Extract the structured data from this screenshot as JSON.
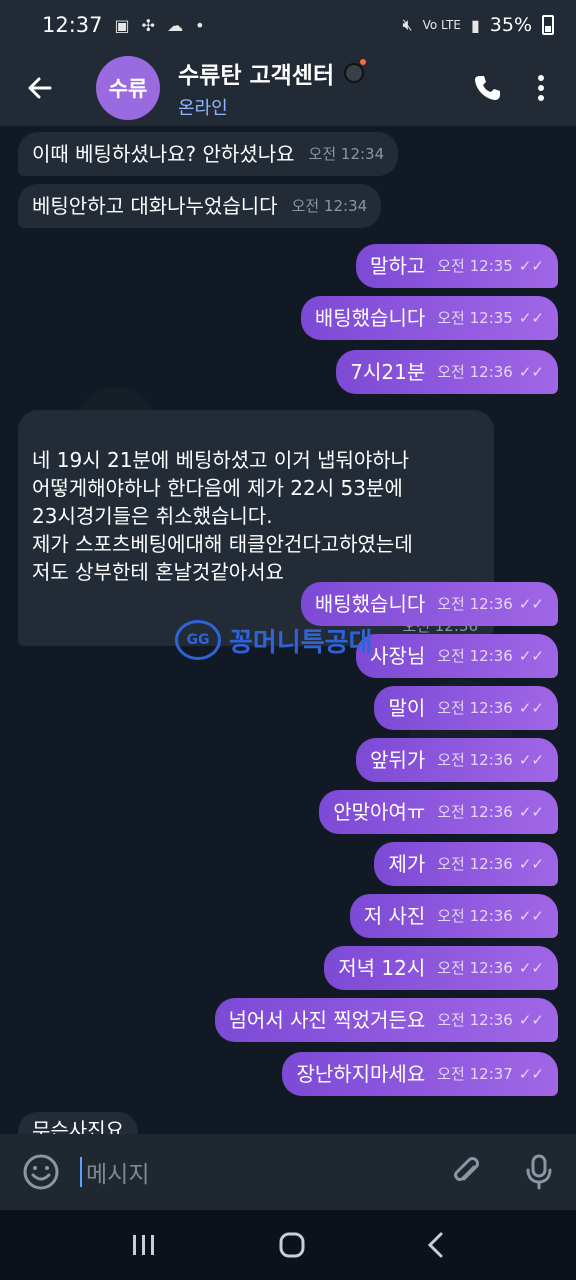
{
  "status_bar": {
    "time": "12:37",
    "dot": "•",
    "carrier": "Vo LTE",
    "battery": "35%"
  },
  "header": {
    "avatar_text": "수류",
    "title": "수류탄 고객센터",
    "status": "온라인"
  },
  "messages": [
    {
      "side": "in",
      "text": "이때 베팅하셨나요? 안하셨나요",
      "time": "오전 12:34"
    },
    {
      "side": "in",
      "text": "베팅안하고 대화나누었습니다",
      "time": "오전 12:34"
    },
    {
      "side": "out",
      "text": "말하고",
      "time": "오전 12:35"
    },
    {
      "side": "out",
      "text": "배팅했습니다",
      "time": "오전 12:35"
    },
    {
      "side": "out",
      "text": "7시21분",
      "time": "오전 12:36"
    },
    {
      "side": "in",
      "text": "네 19시 21분에 베팅하셨고 이거 냅둬야하나\n어떻게해야하나 한다음에 제가 22시 53분에\n23시경기들은 취소했습니다.\n제가 스포츠베팅에대해 태클안건다고하였는데\n저도 상부한테 혼날것같아서요",
      "time": "오전 12:36"
    },
    {
      "side": "out",
      "text": "배팅했습니다",
      "time": "오전 12:36"
    },
    {
      "side": "out",
      "text": "사장님",
      "time": "오전 12:36"
    },
    {
      "side": "out",
      "text": "말이",
      "time": "오전 12:36"
    },
    {
      "side": "out",
      "text": "앞뒤가",
      "time": "오전 12:36"
    },
    {
      "side": "out",
      "text": "안맞아여ㅠ",
      "time": "오전 12:36"
    },
    {
      "side": "out",
      "text": "제가",
      "time": "오전 12:36"
    },
    {
      "side": "out",
      "text": "저 사진",
      "time": "오전 12:36"
    },
    {
      "side": "out",
      "text": "저녁 12시",
      "time": "오전 12:36"
    },
    {
      "side": "out",
      "text": "넘어서 사진 찍었거든요",
      "time": "오전 12:36"
    },
    {
      "side": "out",
      "text": "장난하지마세요",
      "time": "오전 12:37"
    },
    {
      "side": "in",
      "text": "무슨사진요",
      "time": ""
    }
  ],
  "watermark": {
    "badge": "GG",
    "text": "꽁머니특공대"
  },
  "composer": {
    "placeholder": "메시지"
  },
  "colors": {
    "outgoing": "#8a55dc",
    "incoming": "#222b36",
    "accent": "#5aa0ff",
    "background": "#111a24"
  },
  "icons": {
    "back": "arrow-left-icon",
    "call": "phone-icon",
    "menu": "more-vertical-icon",
    "emoji": "smiley-icon",
    "attach": "paperclip-icon",
    "mic": "microphone-icon"
  }
}
